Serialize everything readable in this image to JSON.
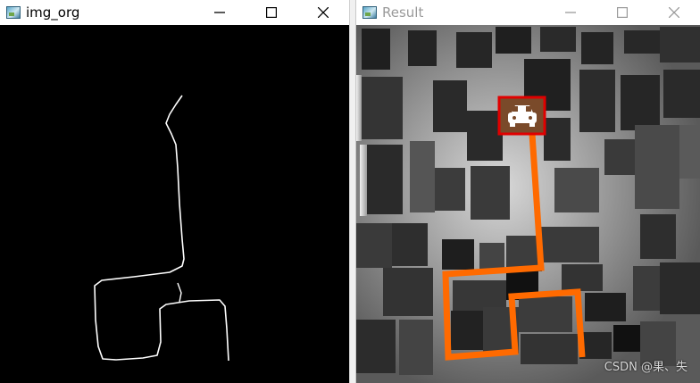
{
  "left_window": {
    "title": "img_org",
    "minimize_icon": "minimize-icon",
    "maximize_icon": "maximize-icon",
    "close_icon": "close-icon"
  },
  "right_window": {
    "title": "Result",
    "minimize_icon": "minimize-icon",
    "maximize_icon": "maximize-icon",
    "close_icon": "close-icon",
    "vehicle_icon": "car-icon"
  },
  "watermark": "CSDN @果、失",
  "colors": {
    "path_line": "#ff6a00",
    "marker_border": "#e00000",
    "trace_line": "#ffffff"
  }
}
